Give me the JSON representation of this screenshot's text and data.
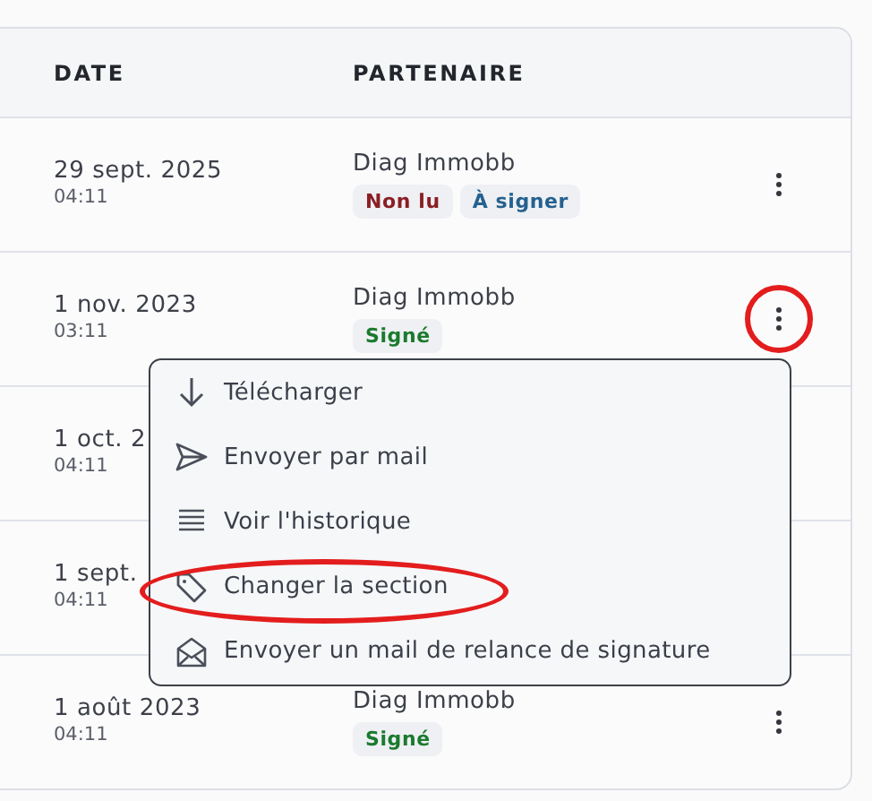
{
  "table": {
    "columns": [
      "DATE",
      "PARTENAIRE"
    ],
    "rows": [
      {
        "date": "29 sept. 2025",
        "time": "04:11",
        "partner": "Diag Immobb",
        "tags": [
          {
            "label": "Non lu",
            "kind": "unread"
          },
          {
            "label": "À signer",
            "kind": "to_sign"
          }
        ],
        "more_button": {
          "highlighted": false
        }
      },
      {
        "date": "1 nov. 2023",
        "time": "03:11",
        "partner": "Diag Immobb",
        "tags": [
          {
            "label": "Signé",
            "kind": "signed"
          }
        ],
        "more_button": {
          "highlighted": true
        }
      },
      {
        "date": "1 oct. 2",
        "time": "04:11"
      },
      {
        "date": "1 sept.",
        "time": "04:11"
      },
      {
        "date": "1 août 2023",
        "time": "04:11",
        "partner": "Diag Immobb",
        "tags": [
          {
            "label": "Signé",
            "kind": "signed"
          }
        ],
        "more_button": {
          "highlighted": false
        }
      }
    ]
  },
  "menu": {
    "items": [
      {
        "label": "Télécharger",
        "kind": "download",
        "highlighted": false
      },
      {
        "label": "Envoyer par mail",
        "kind": "send",
        "highlighted": false
      },
      {
        "label": "Voir l'historique",
        "kind": "history",
        "highlighted": false
      },
      {
        "label": "Changer la section",
        "kind": "tag",
        "highlighted": true
      },
      {
        "label": "Envoyer un mail de relance de signature",
        "kind": "reminder",
        "highlighted": false
      }
    ]
  }
}
